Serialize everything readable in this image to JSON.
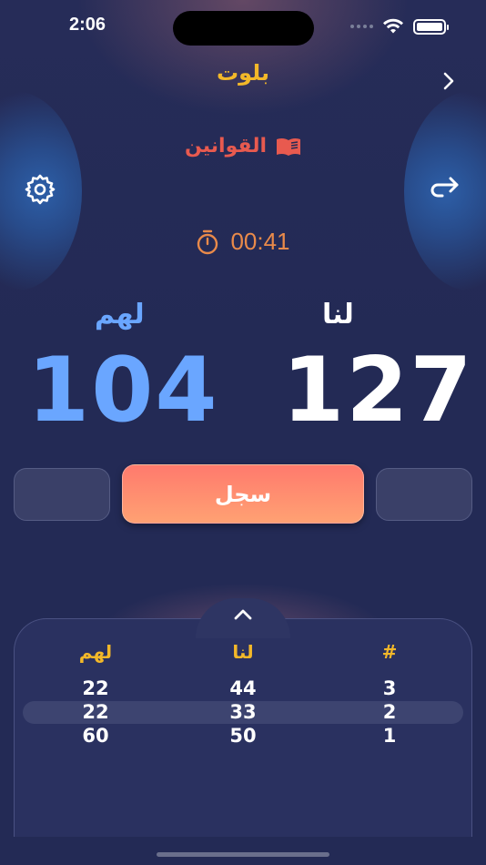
{
  "status_bar": {
    "time": "2:06"
  },
  "header": {
    "title": "بلوت"
  },
  "rules": {
    "label": "القوانين"
  },
  "timer": {
    "value": "00:41"
  },
  "teams": {
    "them": {
      "label": "لهم",
      "score": "104"
    },
    "us": {
      "label": "لنا",
      "score": "127"
    }
  },
  "actions": {
    "record_label": "سجل"
  },
  "history": {
    "columns": {
      "them": "لهم",
      "us": "لنا",
      "number": "#"
    },
    "rows": [
      {
        "number": "3",
        "us": "44",
        "them": "22"
      },
      {
        "number": "2",
        "us": "33",
        "them": "22"
      },
      {
        "number": "1",
        "us": "50",
        "them": "60"
      }
    ]
  },
  "colors": {
    "title": "#f3b829",
    "rules": "#e85a4f",
    "timer": "#e98a4a",
    "them": "#6aa6ff",
    "us": "#ffffff",
    "record_button": "#ff8a6f",
    "background": "#232a55"
  }
}
